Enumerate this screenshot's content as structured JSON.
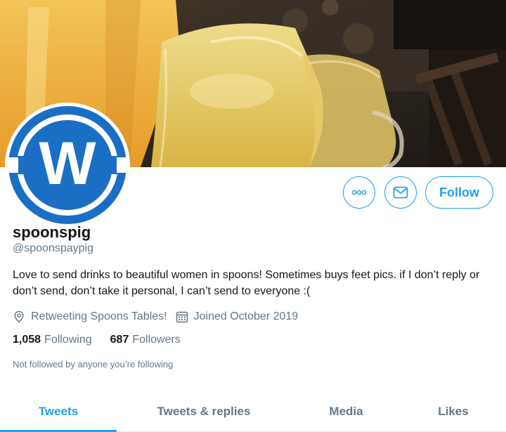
{
  "profile": {
    "display_name": "spoonspig",
    "handle": "@spoonspaypig",
    "bio": "Love to send drinks to beautiful women in spoons! Sometimes buys feet pics. if I don’t reply or don’t send, don’t take it personal, I can’t send to everyone :(",
    "location": "Retweeting Spoons Tables!",
    "joined": "Joined October 2019",
    "following_count": "1,058",
    "following_label": "Following",
    "followers_count": "687",
    "followers_label": "Followers",
    "followed_by_note": "Not followed by anyone you’re following"
  },
  "actions": {
    "more_icon": "more-dots-icon",
    "message_icon": "envelope-icon",
    "follow_label": "Follow"
  },
  "avatar": {
    "logo_letter": "W",
    "logo_color": "#1a6fc4"
  },
  "tabs": [
    {
      "label": "Tweets",
      "active": true
    },
    {
      "label": "Tweets & replies",
      "active": false
    },
    {
      "label": "Media",
      "active": false
    },
    {
      "label": "Likes",
      "active": false
    }
  ],
  "colors": {
    "accent": "#1da1f2",
    "secondary_text": "#657786",
    "primary_text": "#14171a"
  }
}
